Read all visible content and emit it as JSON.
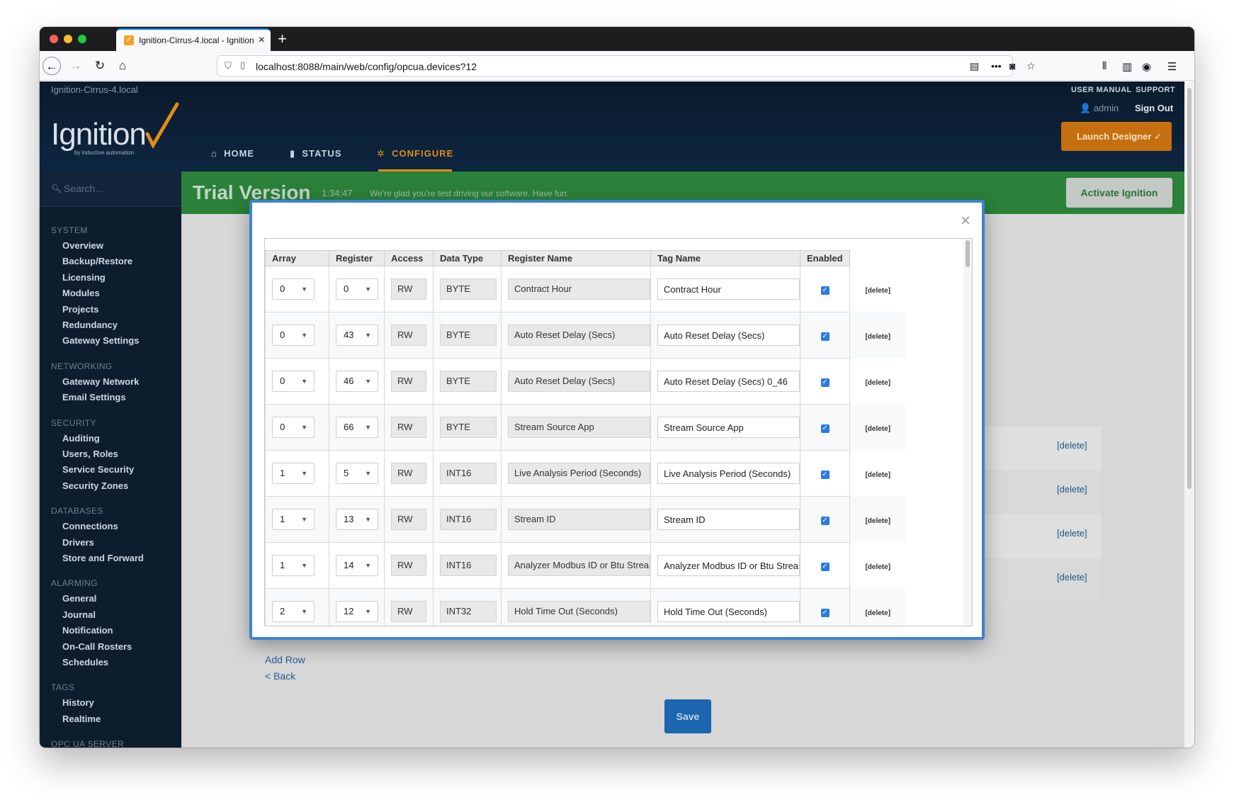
{
  "browser": {
    "tab_title": "Ignition-Cirrus-4.local - Ignition",
    "url": "localhost:8088/main/web/config/opcua.devices?12"
  },
  "header": {
    "host": "Ignition-Cirrus-4.local",
    "user_manual": "USER MANUAL",
    "support": "SUPPORT",
    "user": "admin",
    "sign_out": "Sign Out",
    "launch_designer": "Launch Designer",
    "logo_text": "Ignition",
    "logo_sub": "by inductive automation",
    "nav": {
      "home": "HOME",
      "status": "STATUS",
      "configure": "CONFIGURE"
    },
    "active_nav": "configure",
    "accent_color": "#e38c16"
  },
  "sidebar": {
    "search_placeholder": "Search...",
    "sections": [
      {
        "title": "SYSTEM",
        "items": [
          "Overview",
          "Backup/Restore",
          "Licensing",
          "Modules",
          "Projects",
          "Redundancy",
          "Gateway Settings"
        ]
      },
      {
        "title": "NETWORKING",
        "items": [
          "Gateway Network",
          "Email Settings"
        ]
      },
      {
        "title": "SECURITY",
        "items": [
          "Auditing",
          "Users, Roles",
          "Service Security",
          "Security Zones"
        ]
      },
      {
        "title": "DATABASES",
        "items": [
          "Connections",
          "Drivers",
          "Store and Forward"
        ]
      },
      {
        "title": "ALARMING",
        "items": [
          "General",
          "Journal",
          "Notification",
          "On-Call Rosters",
          "Schedules"
        ]
      },
      {
        "title": "TAGS",
        "items": [
          "History",
          "Realtime"
        ]
      },
      {
        "title": "OPC UA SERVER",
        "items": []
      }
    ]
  },
  "trial": {
    "title": "Trial Version",
    "timer": "1:34:47",
    "message": "We're glad you're test driving our software. Have fun.",
    "activate": "Activate Ignition"
  },
  "background_page": {
    "delete_label": "[delete]",
    "add_row": "Add Row",
    "back": "< Back",
    "save": "Save"
  },
  "modal": {
    "close_icon": "×",
    "columns": [
      "Array",
      "Register",
      "Access",
      "Data Type",
      "Register Name",
      "Tag Name",
      "Enabled"
    ],
    "delete_label": "[delete]",
    "rows": [
      {
        "array": "0",
        "register": "0",
        "access": "RW",
        "data_type": "BYTE",
        "register_name": "Contract Hour",
        "tag_name": "Contract Hour",
        "enabled": true
      },
      {
        "array": "0",
        "register": "43",
        "access": "RW",
        "data_type": "BYTE",
        "register_name": "Auto Reset Delay (Secs)",
        "tag_name": "Auto Reset Delay (Secs)",
        "enabled": true
      },
      {
        "array": "0",
        "register": "46",
        "access": "RW",
        "data_type": "BYTE",
        "register_name": "Auto Reset Delay (Secs)",
        "tag_name": "Auto Reset Delay (Secs) 0_46",
        "enabled": true
      },
      {
        "array": "0",
        "register": "66",
        "access": "RW",
        "data_type": "BYTE",
        "register_name": "Stream Source App",
        "tag_name": "Stream Source App",
        "enabled": true
      },
      {
        "array": "1",
        "register": "5",
        "access": "RW",
        "data_type": "INT16",
        "register_name": "Live Analysis Period (Seconds)",
        "tag_name": "Live Analysis Period (Seconds)",
        "enabled": true
      },
      {
        "array": "1",
        "register": "13",
        "access": "RW",
        "data_type": "INT16",
        "register_name": "Stream ID",
        "tag_name": "Stream ID",
        "enabled": true
      },
      {
        "array": "1",
        "register": "14",
        "access": "RW",
        "data_type": "INT16",
        "register_name": "Analyzer Modbus ID or Btu Stream",
        "tag_name": "Analyzer Modbus ID or Btu Stream",
        "enabled": true
      },
      {
        "array": "2",
        "register": "12",
        "access": "RW",
        "data_type": "INT32",
        "register_name": "Hold Time Out (Seconds)",
        "tag_name": "Hold Time Out (Seconds)",
        "enabled": true
      }
    ]
  }
}
